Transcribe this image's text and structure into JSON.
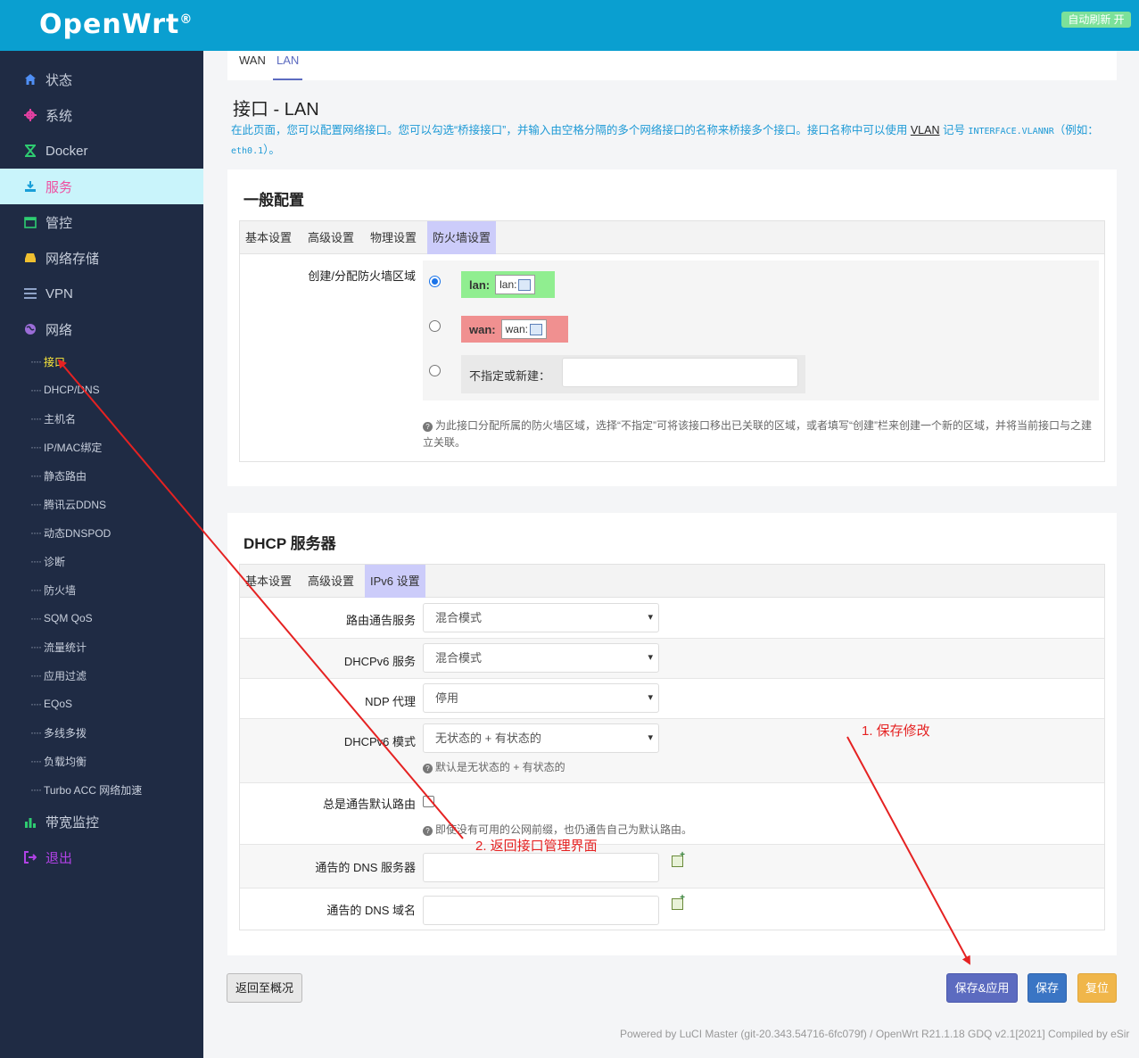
{
  "header": {
    "logo": "OpenWrt",
    "logo_mark": "®",
    "refresh_label": "自动刷新 开"
  },
  "sidebar": {
    "items": [
      {
        "label": "状态",
        "icon": "home-icon"
      },
      {
        "label": "系统",
        "icon": "gear-icon"
      },
      {
        "label": "Docker",
        "icon": "hourglass-icon"
      },
      {
        "label": "服务",
        "icon": "download-icon"
      },
      {
        "label": "管控",
        "icon": "calendar-icon"
      },
      {
        "label": "网络存储",
        "icon": "drive-icon"
      },
      {
        "label": "VPN",
        "icon": "list-icon"
      },
      {
        "label": "网络",
        "icon": "globe-icon"
      }
    ],
    "subitems": [
      "接口",
      "DHCP/DNS",
      "主机名",
      "IP/MAC绑定",
      "静态路由",
      "腾讯云DDNS",
      "动态DNSPOD",
      "诊断",
      "防火墙",
      "SQM QoS",
      "流量统计",
      "应用过滤",
      "EQoS",
      "多线多拨",
      "负载均衡",
      "Turbo ACC 网络加速"
    ],
    "bottom_items": [
      {
        "label": "带宽监控",
        "icon": "bar-chart-icon"
      },
      {
        "label": "退出",
        "icon": "logout-icon"
      }
    ],
    "colors": {
      "bg": "#1f2b44",
      "active_bg": "#c9f4fb",
      "active_text": "#ef4da0",
      "active_sub": "#ffeb3b"
    }
  },
  "top_tabs": [
    "WAN",
    "LAN"
  ],
  "page": {
    "title": "接口 - LAN",
    "desc_part1": "在此页面，您可以配置网络接口。您可以勾选“桥接接口”，并输入由空格分隔的多个网络接口的名称来桥接多个接口。接口名称中可以使用 ",
    "desc_link": "VLAN",
    "desc_part2": " 记号 ",
    "desc_code1": "INTERFACE.VLANNR",
    "desc_part3": "（例如：",
    "desc_code2": "eth0.1",
    "desc_part4": "）。"
  },
  "general": {
    "title": "一般配置",
    "tabs": [
      "基本设置",
      "高级设置",
      "物理设置",
      "防火墙设置"
    ],
    "firewall_label": "创建/分配防火墙区域",
    "zones": [
      {
        "name": "lan:",
        "chip": "lan:",
        "color": "#90ee90"
      },
      {
        "name": "wan:",
        "chip": "wan:",
        "color": "#f09090"
      }
    ],
    "unspecified_label": "不指定或新建：",
    "unspecified_value": "",
    "help": "为此接口分配所属的防火墙区域，选择“不指定”可将该接口移出已关联的区域，或者填写“创建”栏来创建一个新的区域，并将当前接口与之建立关联。"
  },
  "dhcp": {
    "title": "DHCP 服务器",
    "tabs": [
      "基本设置",
      "高级设置",
      "IPv6 设置"
    ],
    "router_adv_label": "路由通告服务",
    "router_adv_value": "混合模式",
    "dhcpv6_label": "DHCPv6 服务",
    "dhcpv6_value": "混合模式",
    "ndp_label": "NDP 代理",
    "ndp_value": "停用",
    "dhcpv6_mode_label": "DHCPv6 模式",
    "dhcpv6_mode_value": "无状态的 + 有状态的",
    "dhcpv6_mode_help": "默认是无状态的 + 有状态的",
    "default_route_label": "总是通告默认路由",
    "default_route_help": "即使没有可用的公网前缀，也仍通告自己为默认路由。",
    "dns_server_label": "通告的 DNS 服务器",
    "dns_server_value": "",
    "dns_domain_label": "通告的 DNS 域名",
    "dns_domain_value": ""
  },
  "buttons": {
    "back": "返回至概况",
    "save_apply": "保存&应用",
    "save": "保存",
    "reset": "复位"
  },
  "footer": "Powered by LuCI Master (git-20.343.54716-6fc079f) / OpenWrt R21.1.18 GDQ v2.1[2021] Compiled by eSir",
  "annotations": {
    "step1": "1. 保存修改",
    "step2": "2. 返回接口管理界面",
    "color": "#e52222"
  }
}
